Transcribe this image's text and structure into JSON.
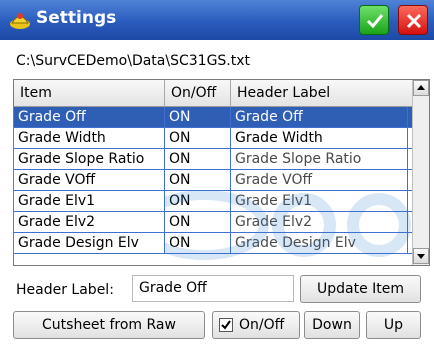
{
  "window": {
    "title": "Settings",
    "ok_icon": "checkmark-icon",
    "close_icon": "close-icon",
    "colors": {
      "titlebar": "#2a5bbd",
      "ok": "#1aa31a",
      "close": "#d41111",
      "selection": "#2f5fb5"
    }
  },
  "file_path": "C:\\SurvCEDemo\\Data\\SC31GS.txt",
  "table": {
    "headers": {
      "item": "Item",
      "onoff": "On/Off",
      "label": "Header Label"
    },
    "rows": [
      {
        "item": "Grade Off",
        "onoff": "ON",
        "label": "Grade Off",
        "selected": true
      },
      {
        "item": "Grade Width",
        "onoff": "ON",
        "label": "Grade Width"
      },
      {
        "item": "Grade Slope Ratio",
        "onoff": "ON",
        "label": "Grade Slope Ratio"
      },
      {
        "item": "Grade VOff",
        "onoff": "ON",
        "label": "Grade VOff"
      },
      {
        "item": "Grade Elv1",
        "onoff": "ON",
        "label": "Grade Elv1"
      },
      {
        "item": "Grade Elv2",
        "onoff": "ON",
        "label": "Grade Elv2"
      },
      {
        "item": "Grade Design Elv",
        "onoff": "ON",
        "label": "Grade Design Elv"
      }
    ]
  },
  "header_label": {
    "label": "Header Label:",
    "value": "Grade Off"
  },
  "buttons": {
    "update_item": "Update Item",
    "cutsheet": "Cutsheet from Raw",
    "onoff": "On/Off",
    "down": "Down",
    "up": "Up"
  },
  "onoff_checked": true
}
